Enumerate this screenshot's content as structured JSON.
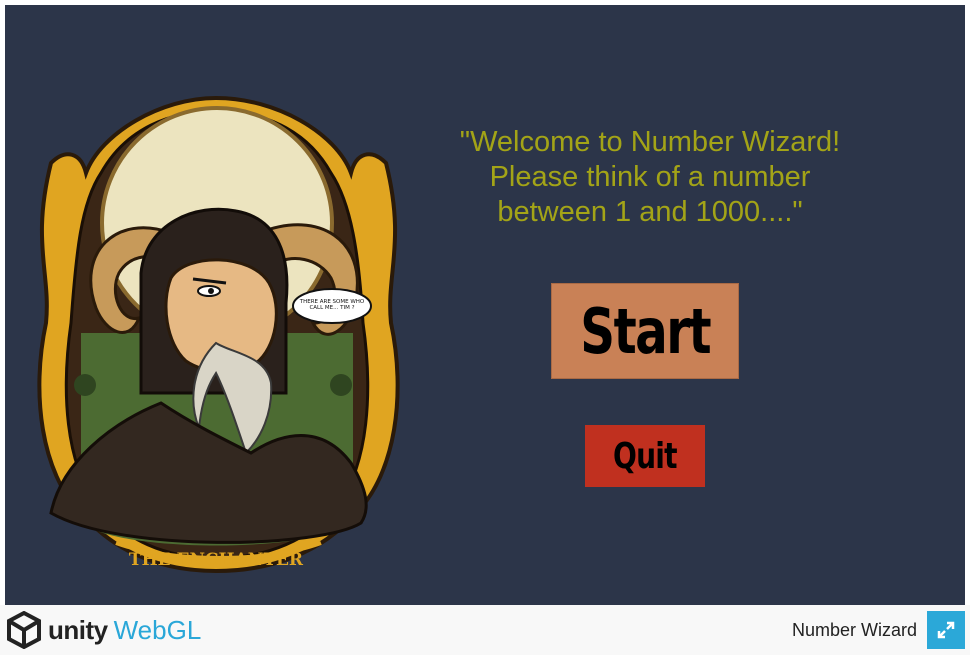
{
  "game": {
    "welcome_text": "\"Welcome to Number Wizard!\nPlease think of a number\nbetween 1 and 1000....\"",
    "start_label": "Start",
    "quit_label": "Quit",
    "art": {
      "banner_text": "THE ENCHANTER",
      "speech_text": "THERE ARE SOME WHO CALL ME... TIM ?"
    }
  },
  "footer": {
    "unity_label": "unity",
    "webgl_label": "WebGL",
    "title": "Number Wizard"
  },
  "colors": {
    "canvas_bg": "#2c3549",
    "welcome_text": "#a3a417",
    "start_button": "#c98156",
    "quit_button": "#c0301f",
    "webgl_blue": "#2aa7d8",
    "fullscreen_bg": "#2ba8d8"
  },
  "icons": {
    "unity": "unity-logo-icon",
    "fullscreen": "fullscreen-expand-icon"
  }
}
